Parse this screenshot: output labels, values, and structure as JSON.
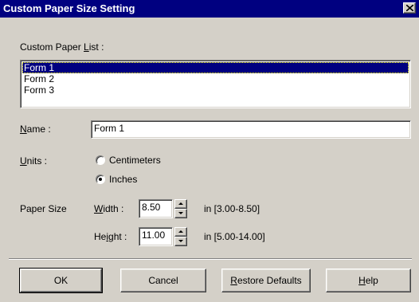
{
  "window": {
    "title": "Custom Paper Size Setting",
    "close_glyph": "×"
  },
  "list": {
    "label_prefix": "Custom Paper ",
    "label_mnemonic": "L",
    "label_suffix": "ist :",
    "items": [
      "Form 1",
      "Form 2",
      "Form 3"
    ],
    "selected": "Form 1"
  },
  "name": {
    "label_mnemonic": "N",
    "label_suffix": "ame :",
    "value": "Form 1"
  },
  "units": {
    "label_mnemonic": "U",
    "label_suffix": "nits :",
    "options": [
      "Centimeters",
      "Inches"
    ],
    "selected": "Inches"
  },
  "paper_size": {
    "label": "Paper Size",
    "width": {
      "label_mnemonic": "W",
      "label_suffix": "idth :",
      "value": "8.50",
      "range": "in [3.00-8.50]"
    },
    "height": {
      "label_prefix": "He",
      "label_mnemonic": "i",
      "label_suffix": "ght :",
      "value": "11.00",
      "range": "in [5.00-14.00]"
    }
  },
  "buttons": {
    "ok": "OK",
    "cancel": "Cancel",
    "restore_mnemonic": "R",
    "restore_suffix": "estore Defaults",
    "help_mnemonic": "H",
    "help_suffix": "elp"
  },
  "colors": {
    "titlebar": "#000080",
    "dialog_bg": "#d4d0c8",
    "selection": "#000080"
  }
}
